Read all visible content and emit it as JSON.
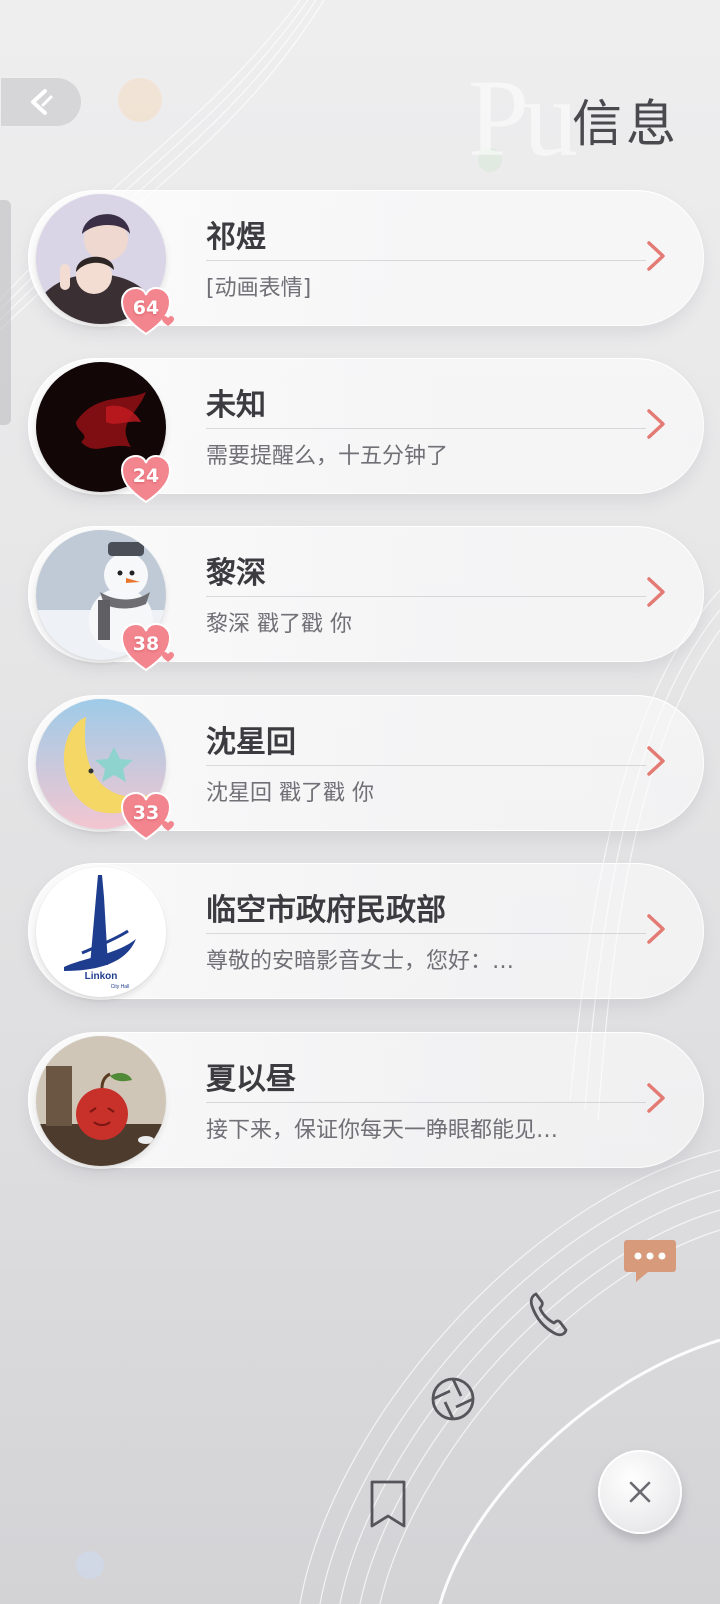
{
  "header": {
    "title": "信息",
    "back_icon": "back-arrow-icon"
  },
  "chats": [
    {
      "name": "祁煜",
      "preview": "[动画表情]",
      "affinity": "64"
    },
    {
      "name": "未知",
      "preview": "需要提醒么，十五分钟了",
      "affinity": "24"
    },
    {
      "name": "黎深",
      "preview": "黎深 戳了戳 你",
      "affinity": "38"
    },
    {
      "name": "沈星回",
      "preview": "沈星回 戳了戳 你",
      "affinity": "33"
    },
    {
      "name": "临空市政府民政部",
      "preview": "尊敬的安暗影音女士，您好：…",
      "affinity": ""
    },
    {
      "name": "夏以昼",
      "preview": "接下来，保证你每天一睁眼都能见…",
      "affinity": ""
    }
  ],
  "avatar_logo_text": {
    "line1": "Linkon",
    "line2": "City Hall"
  },
  "fab_menu": {
    "items": [
      "chat-bubble-icon",
      "phone-icon",
      "moments-icon",
      "bookmark-icon"
    ],
    "active_color": "#d79a7a"
  },
  "colors": {
    "chevron": "#e37b74",
    "heart": "#f2858e",
    "title": "#4a4a4e"
  }
}
